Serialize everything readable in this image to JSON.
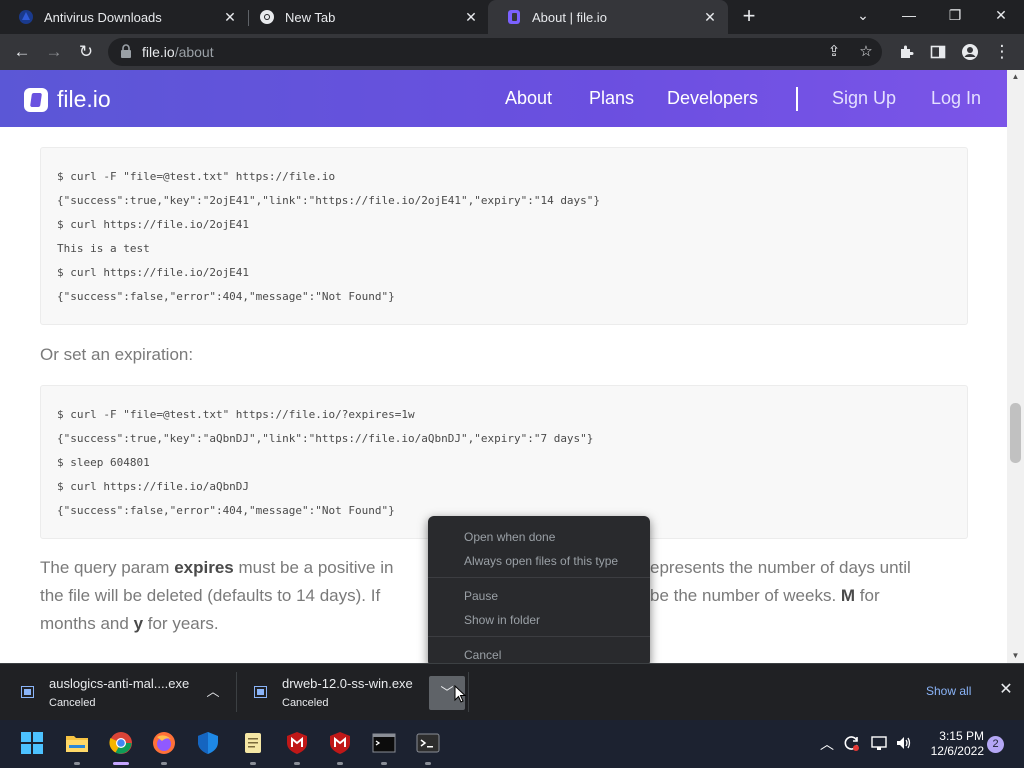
{
  "browser": {
    "tabs": [
      {
        "title": "Antivirus Downloads",
        "favicon": "avast-favicon",
        "active": false
      },
      {
        "title": "New Tab",
        "favicon": "chrome-favicon",
        "active": false
      },
      {
        "title": "About | file.io",
        "favicon": "fileio-favicon",
        "active": true
      }
    ],
    "address": {
      "domain": "file.io",
      "path": "/about"
    }
  },
  "site": {
    "logo_text": "file.io",
    "nav": [
      "About",
      "Plans",
      "Developers"
    ],
    "auth": [
      "Sign Up",
      "Log In"
    ],
    "accent": "#6a52e0"
  },
  "content": {
    "code_block_1": [
      "$ curl -F \"file=@test.txt\" https://file.io",
      "{\"success\":true,\"key\":\"2ojE41\",\"link\":\"https://file.io/2ojE41\",\"expiry\":\"14 days\"}",
      "$ curl https://file.io/2ojE41",
      "This is a test",
      "$ curl https://file.io/2ojE41",
      "{\"success\":false,\"error\":404,\"message\":\"Not Found\"}"
    ],
    "expiration_heading": "Or set an expiration:",
    "code_block_2": [
      "$ curl -F \"file=@test.txt\" https://file.io/?expires=1w",
      "{\"success\":true,\"key\":\"aQbnDJ\",\"link\":\"https://file.io/aQbnDJ\",\"expiry\":\"7 days\"}",
      "$ sleep 604801",
      "$ curl https://file.io/aQbnDJ",
      "{\"success\":false,\"error\":404,\"message\":\"Not Found\"}"
    ],
    "para": {
      "l1a": "The query param ",
      "l1b": "expires",
      "l1c": " must be a positive in",
      "l1d": "epresents the number of days until",
      "l2a": "the file will be deleted (defaults to 14 days). If",
      "l2b": " be the number of weeks. ",
      "l2c": "M",
      "l2d": " for",
      "l3a": "months and ",
      "l3b": "y",
      "l3c": " for years."
    }
  },
  "context_menu": {
    "items_group1": [
      "Open when done",
      "Always open files of this type"
    ],
    "items_group2": [
      "Pause",
      "Show in folder"
    ],
    "items_group3": [
      "Cancel"
    ]
  },
  "downloads": {
    "items": [
      {
        "name": "auslogics-anti-mal....exe",
        "status": "Canceled"
      },
      {
        "name": "drweb-12.0-ss-win.exe",
        "status": "Canceled"
      }
    ],
    "show_all": "Show all"
  },
  "taskbar": {
    "time": "3:15 PM",
    "date": "12/6/2022",
    "notification_count": "2"
  }
}
